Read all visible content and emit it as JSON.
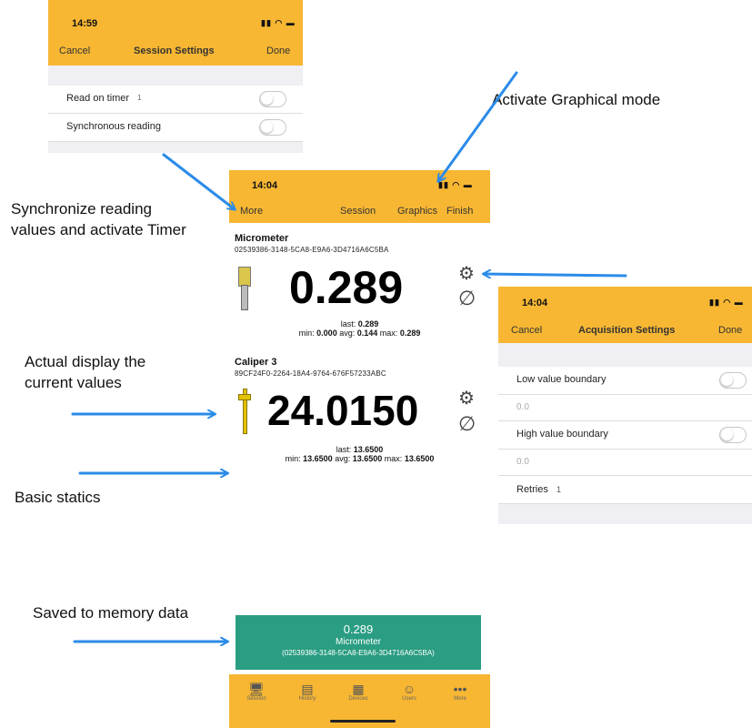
{
  "session_settings": {
    "time": "14:59",
    "cancel": "Cancel",
    "title": "Session Settings",
    "done": "Done",
    "rows": [
      {
        "label": "Read on timer",
        "badge": "1"
      },
      {
        "label": "Synchronous reading",
        "badge": ""
      }
    ]
  },
  "main_screen": {
    "time": "14:04",
    "more": "More",
    "session": "Session",
    "graphics": "Graphics",
    "finish": "Finish",
    "instruments": [
      {
        "name": "Micrometer",
        "id": "02539386-3148-5CA8-E9A6-3D4716A6C5BA",
        "value": "0.289",
        "last_label": "last:",
        "last": "0.289",
        "min_label": "min:",
        "min": "0.000",
        "avg_label": "avg:",
        "avg": "0.144",
        "max_label": "max:",
        "max": "0.289"
      },
      {
        "name": "Caliper 3",
        "id": "89CF24F0-2264-18A4-9764-676F57233ABC",
        "value": "24.0150",
        "last_label": "last:",
        "last": "13.6500",
        "min_label": "min:",
        "min": "13.6500",
        "avg_label": "avg:",
        "avg": "13.6500",
        "max_label": "max:",
        "max": "13.6500"
      }
    ]
  },
  "acquisition_settings": {
    "time": "14:04",
    "cancel": "Cancel",
    "title": "Acquisition Settings",
    "done": "Done",
    "low_label": "Low value boundary",
    "low_value": "0.0",
    "high_label": "High value boundary",
    "high_value": "0.0",
    "retries_label": "Retries",
    "retries_value": "1"
  },
  "saved_card": {
    "value": "0.289",
    "name": "Micrometer",
    "id": "(02539386-3148-5CA8-E9A6-3D4716A6C5BA)",
    "color": "#2a9d82"
  },
  "tabbar": [
    {
      "label": "Session",
      "icon": "monitor-icon"
    },
    {
      "label": "History",
      "icon": "document-icon"
    },
    {
      "label": "Devices",
      "icon": "devices-icon"
    },
    {
      "label": "Users",
      "icon": "users-icon"
    },
    {
      "label": "More",
      "icon": "more-dots-icon"
    }
  ],
  "annotations": {
    "graphical": "Activate Graphical mode",
    "sync": "Synchronize reading values and activate Timer",
    "display": "Actual display the current values",
    "statics": "Basic statics",
    "saved": "Saved to memory data"
  },
  "colors": {
    "accent": "#f7b733",
    "arrow": "#2b8be8",
    "card": "#2a9d82"
  }
}
